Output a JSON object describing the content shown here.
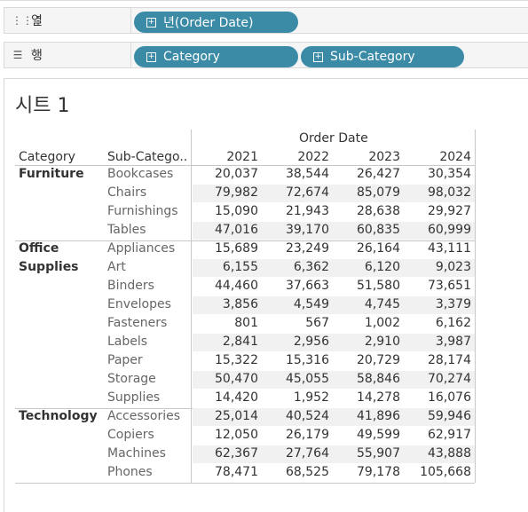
{
  "shelves": {
    "columns": {
      "label": "열",
      "pills": [
        {
          "text": "년(Order Date)"
        }
      ]
    },
    "rows": {
      "label": "행",
      "pills": [
        {
          "text": "Category"
        },
        {
          "text": "Sub-Category"
        }
      ]
    }
  },
  "sheet": {
    "title": "시트 1"
  },
  "table": {
    "column_header_title": "Order Date",
    "category_header": "Category",
    "subcategory_header": "Sub-Catego..",
    "years": [
      "2021",
      "2022",
      "2023",
      "2024"
    ],
    "categories": [
      {
        "name_lines": [
          "Furniture"
        ],
        "rows": [
          {
            "sub": "Bookcases",
            "values": [
              "20,037",
              "38,544",
              "26,427",
              "30,354"
            ]
          },
          {
            "sub": "Chairs",
            "values": [
              "79,982",
              "72,674",
              "85,079",
              "98,032"
            ]
          },
          {
            "sub": "Furnishings",
            "values": [
              "15,090",
              "21,943",
              "28,638",
              "29,927"
            ]
          },
          {
            "sub": "Tables",
            "values": [
              "47,016",
              "39,170",
              "60,835",
              "60,999"
            ]
          }
        ]
      },
      {
        "name_lines": [
          "Office",
          "Supplies"
        ],
        "rows": [
          {
            "sub": "Appliances",
            "values": [
              "15,689",
              "23,249",
              "26,164",
              "43,111"
            ]
          },
          {
            "sub": "Art",
            "values": [
              "6,155",
              "6,362",
              "6,120",
              "9,023"
            ]
          },
          {
            "sub": "Binders",
            "values": [
              "44,460",
              "37,663",
              "51,580",
              "73,651"
            ]
          },
          {
            "sub": "Envelopes",
            "values": [
              "3,856",
              "4,549",
              "4,745",
              "3,379"
            ]
          },
          {
            "sub": "Fasteners",
            "values": [
              "801",
              "567",
              "1,002",
              "6,162"
            ]
          },
          {
            "sub": "Labels",
            "values": [
              "2,841",
              "2,956",
              "2,910",
              "3,987"
            ]
          },
          {
            "sub": "Paper",
            "values": [
              "15,322",
              "15,316",
              "20,729",
              "28,174"
            ]
          },
          {
            "sub": "Storage",
            "values": [
              "50,470",
              "45,055",
              "58,846",
              "70,274"
            ]
          },
          {
            "sub": "Supplies",
            "values": [
              "14,420",
              "1,952",
              "14,278",
              "16,076"
            ]
          }
        ]
      },
      {
        "name_lines": [
          "Technology"
        ],
        "rows": [
          {
            "sub": "Accessories",
            "values": [
              "25,014",
              "40,524",
              "41,896",
              "59,946"
            ]
          },
          {
            "sub": "Copiers",
            "values": [
              "12,050",
              "26,179",
              "49,599",
              "62,917"
            ]
          },
          {
            "sub": "Machines",
            "values": [
              "62,367",
              "27,764",
              "55,907",
              "43,888"
            ]
          },
          {
            "sub": "Phones",
            "values": [
              "78,471",
              "68,525",
              "79,178",
              "105,668"
            ]
          }
        ]
      }
    ]
  }
}
